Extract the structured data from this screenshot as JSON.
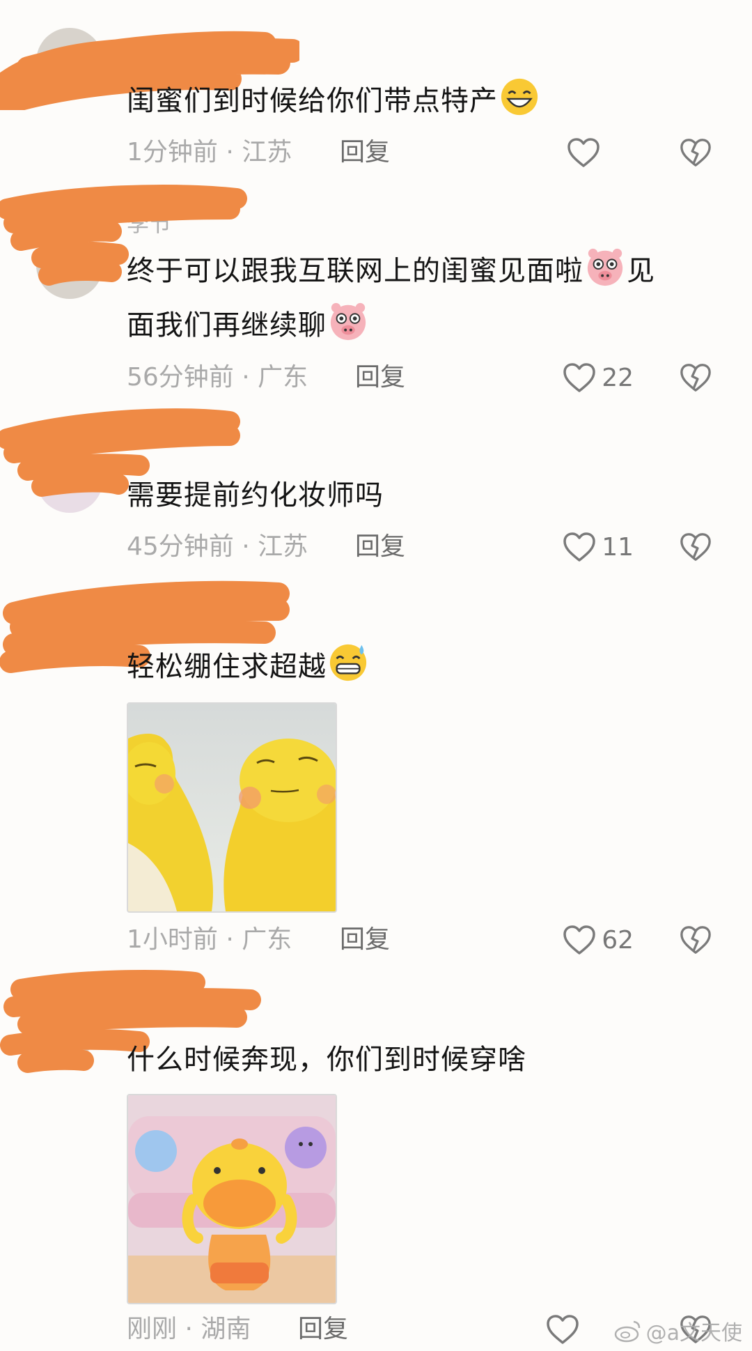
{
  "comments": [
    {
      "text": "闺蜜们到时候给你们带点特产",
      "emoji_icon": "grinning-face-emoji",
      "time": "1分钟前",
      "location": "江苏",
      "separator": "·",
      "reply": "回复",
      "likes": ""
    },
    {
      "text_part1": "终于可以跟我互联网上的闺蜜见面啦",
      "emoji_icon": "pig-face-emoji",
      "text_part2": "见",
      "text_part3": "面我们再继续聊",
      "username_fragment": "李节",
      "time": "56分钟前",
      "location": "广东",
      "separator": "·",
      "reply": "回复",
      "likes": "22"
    },
    {
      "text": "需要提前约化妆师吗",
      "time": "45分钟前",
      "location": "江苏",
      "separator": "·",
      "reply": "回复",
      "likes": "11"
    },
    {
      "text": "轻松绷住求超越",
      "emoji_icon": "grimacing-sweat-emoji",
      "picture_icon": "yellow-creatures-sticker-image",
      "time": "1小时前",
      "location": "广东",
      "separator": "·",
      "reply": "回复",
      "likes": "62"
    },
    {
      "text": "什么时候奔现，你们到时候穿啥",
      "picture_icon": "orange-duck-sticker-image",
      "time": "刚刚",
      "location": "湖南",
      "separator": "·",
      "reply": "回复",
      "likes": ""
    }
  ],
  "watermark": "@a文天使",
  "colors": {
    "background": "#fdfcfa",
    "scribble": "#ef8a45",
    "meta_text": "#a9a9a9",
    "icon_grey": "#777777"
  }
}
